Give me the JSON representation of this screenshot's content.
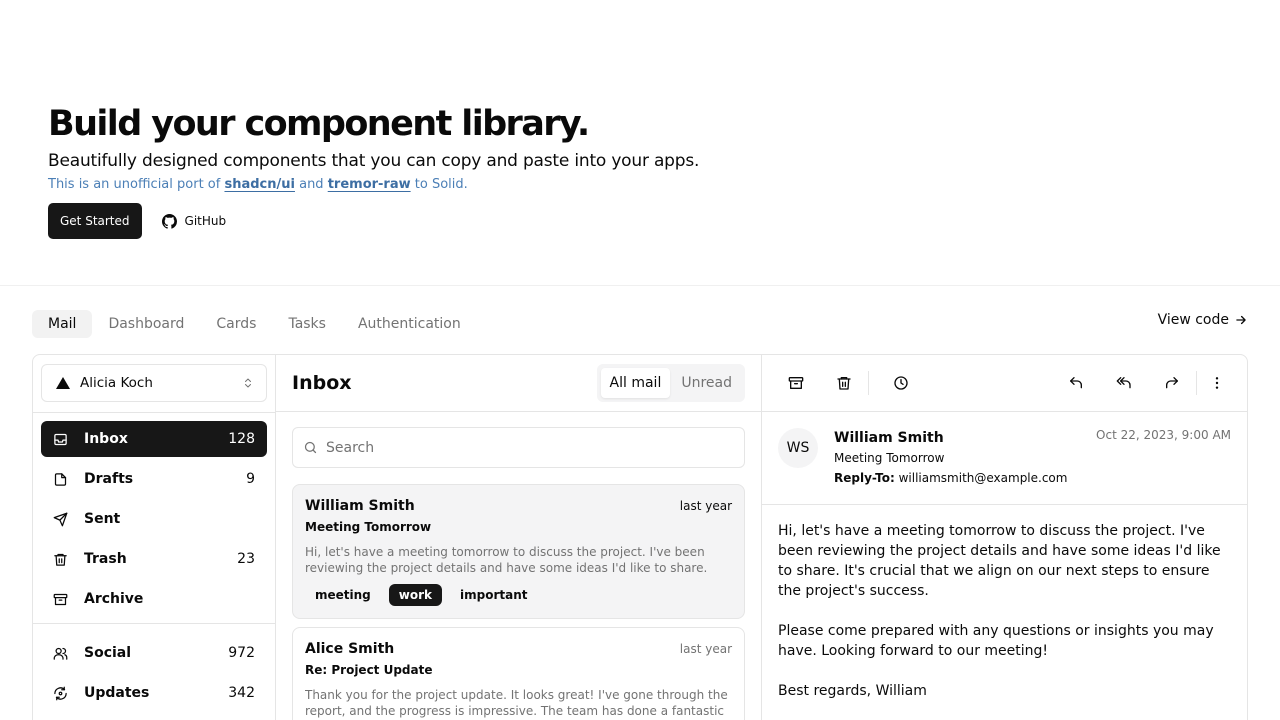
{
  "hero": {
    "title": "Build your component library.",
    "subtitle": "Beautifully designed components that you can copy and paste into your apps.",
    "note_prefix": "This is an unofficial port of ",
    "link1": "shadcn/ui",
    "note_mid": " and ",
    "link2": "tremor-raw",
    "note_suffix": " to Solid.",
    "get_started": "Get Started",
    "github": "GitHub"
  },
  "tabs": [
    "Mail",
    "Dashboard",
    "Cards",
    "Tasks",
    "Authentication"
  ],
  "active_tab": "Mail",
  "view_code": "View code",
  "account": {
    "name": "Alicia Koch"
  },
  "nav_primary": [
    {
      "label": "Inbox",
      "count": "128",
      "icon": "inbox-icon"
    },
    {
      "label": "Drafts",
      "count": "9",
      "icon": "file-icon"
    },
    {
      "label": "Sent",
      "count": "",
      "icon": "send-icon"
    },
    {
      "label": "Trash",
      "count": "23",
      "icon": "trash-icon"
    },
    {
      "label": "Archive",
      "count": "",
      "icon": "archive-icon"
    }
  ],
  "nav_secondary": [
    {
      "label": "Social",
      "count": "972",
      "icon": "users-icon"
    },
    {
      "label": "Updates",
      "count": "342",
      "icon": "refresh-icon"
    }
  ],
  "inbox": {
    "title": "Inbox",
    "filter_all": "All mail",
    "filter_unread": "Unread",
    "search_placeholder": "Search"
  },
  "mails": [
    {
      "from": "William Smith",
      "date": "last year",
      "subject": "Meeting Tomorrow",
      "preview": "Hi, let's have a meeting tomorrow to discuss the project. I've been reviewing the project details and have some ideas I'd like to share. It's...",
      "tags": [
        "meeting",
        "work",
        "important"
      ]
    },
    {
      "from": "Alice Smith",
      "date": "last year",
      "subject": "Re: Project Update",
      "preview": "Thank you for the project update. It looks great! I've gone through the report, and the progress is impressive. The team has done a fantastic job,...",
      "tags": []
    }
  ],
  "message": {
    "initials": "WS",
    "from": "William Smith",
    "subject": "Meeting Tomorrow",
    "reply_to_label": "Reply-To:",
    "reply_to": "williamsmith@example.com",
    "date": "Oct 22, 2023, 9:00 AM",
    "body": "Hi, let's have a meeting tomorrow to discuss the project. I've been reviewing the project details and have some ideas I'd like to share. It's crucial that we align on our next steps to ensure the project's success.\n\nPlease come prepared with any questions or insights you may have. Looking forward to our meeting!\n\nBest regards, William"
  }
}
